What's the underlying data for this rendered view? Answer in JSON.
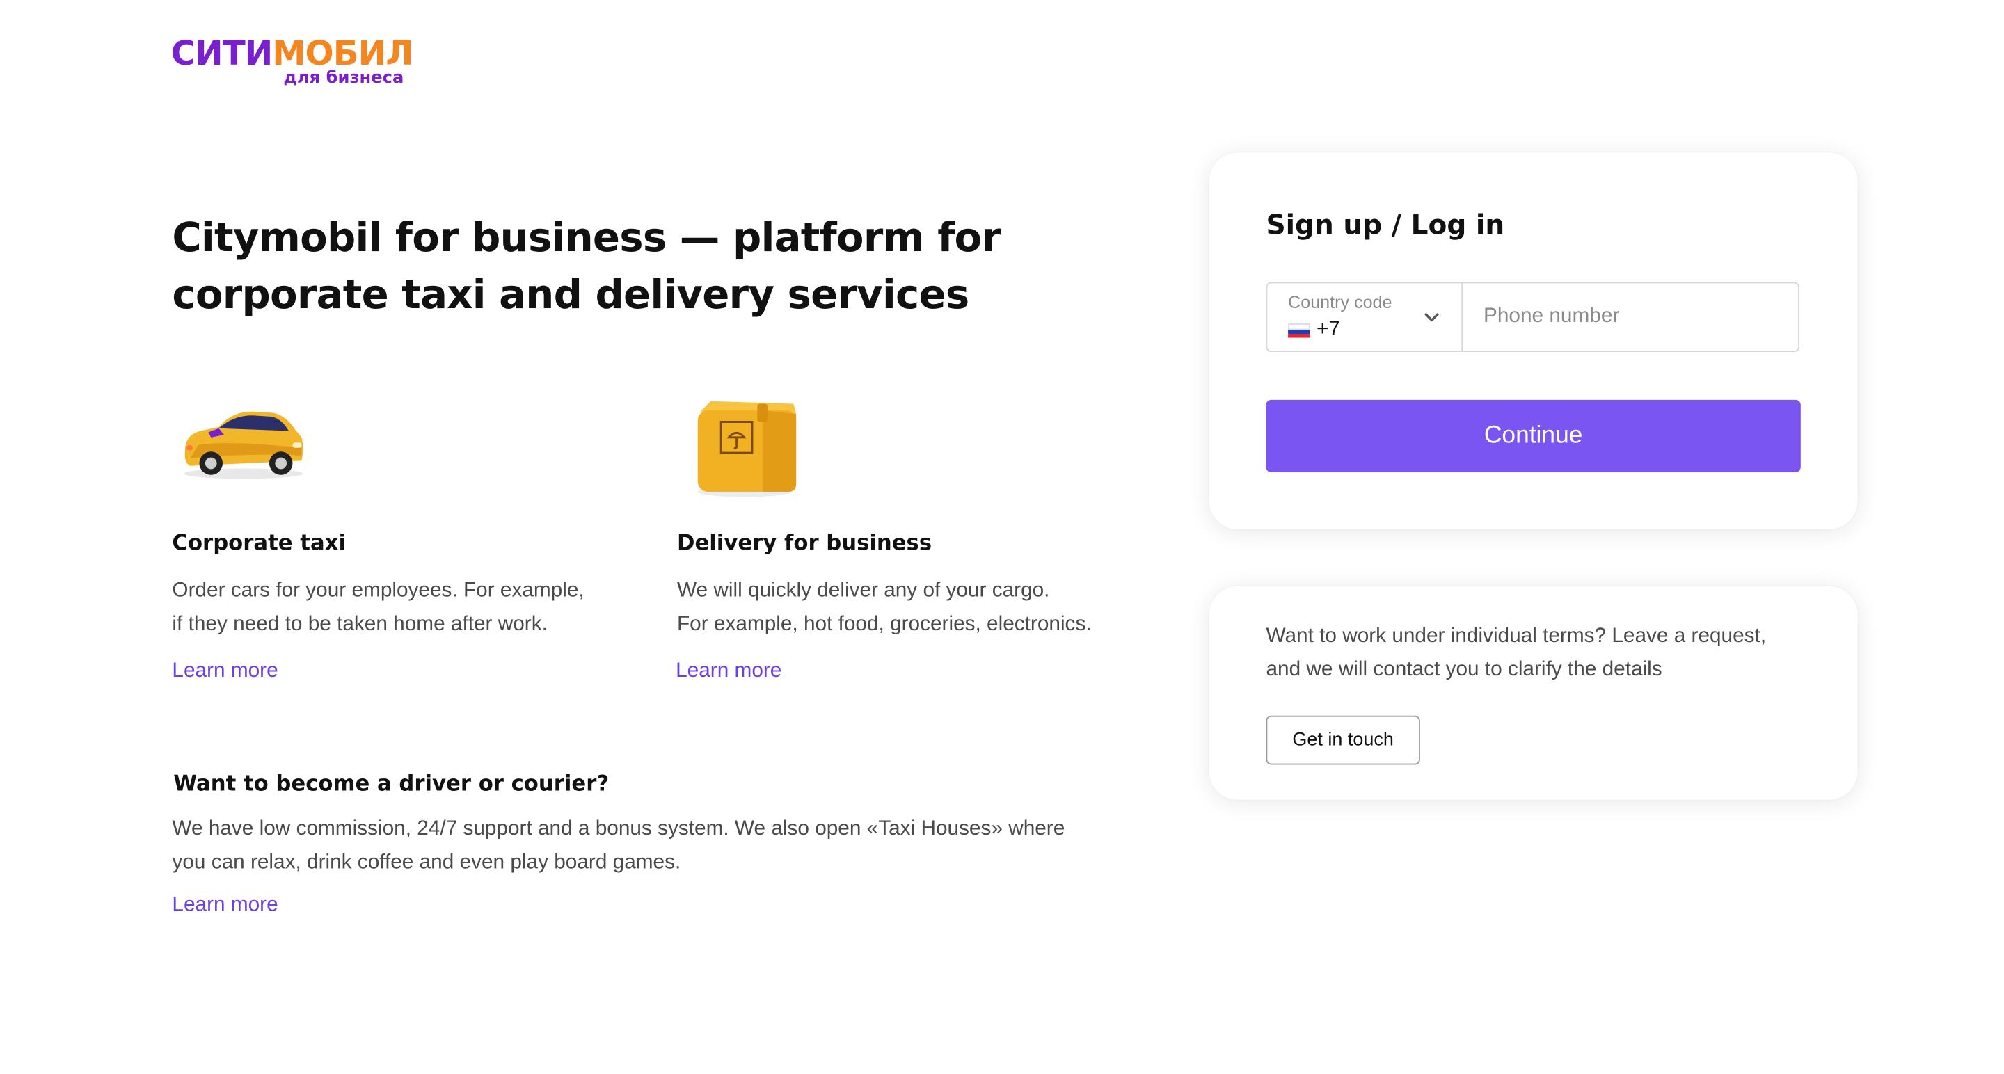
{
  "brand": {
    "logo_part1": "СИТИ",
    "logo_part2": "МОБИЛ",
    "logo_sub": "для бизнеса",
    "colors": {
      "purple": "#7a1fd0",
      "orange": "#f5861f",
      "accent": "#7a55f2",
      "link": "#6b3fe0"
    }
  },
  "hero": {
    "title_line1": "Citymobil for business — platform for",
    "title_line2": "corporate taxi and delivery services"
  },
  "features": [
    {
      "icon": "taxi-car-icon",
      "title": "Corporate taxi",
      "desc_line1": "Order cars for your employees. For example,",
      "desc_line2": "if they need to be taken home after work.",
      "link": "Learn more"
    },
    {
      "icon": "cargo-box-icon",
      "title": "Delivery for business",
      "desc_line1": "We will quickly deliver any of your cargo.",
      "desc_line2": "For example, hot food, groceries, electronics.",
      "link": "Learn more"
    }
  ],
  "driver": {
    "title": "Want to become a driver or courier?",
    "desc_line1": "We have low commission, 24/7 support and a bonus system. We also open «Taxi Houses» where",
    "desc_line2": "you can relax, drink coffee and even play board games.",
    "link": "Learn more"
  },
  "login": {
    "title": "Sign up / Log in",
    "country_label": "Country code",
    "country_value": "+7",
    "country_flag_icon": "russia-flag-icon",
    "phone_placeholder": "Phone number",
    "phone_value": "",
    "continue_label": "Continue"
  },
  "contact": {
    "text_line1": "Want to work under individual terms? Leave a request,",
    "text_line2": "and we will contact you to clarify the details",
    "button_label": "Get in touch"
  }
}
